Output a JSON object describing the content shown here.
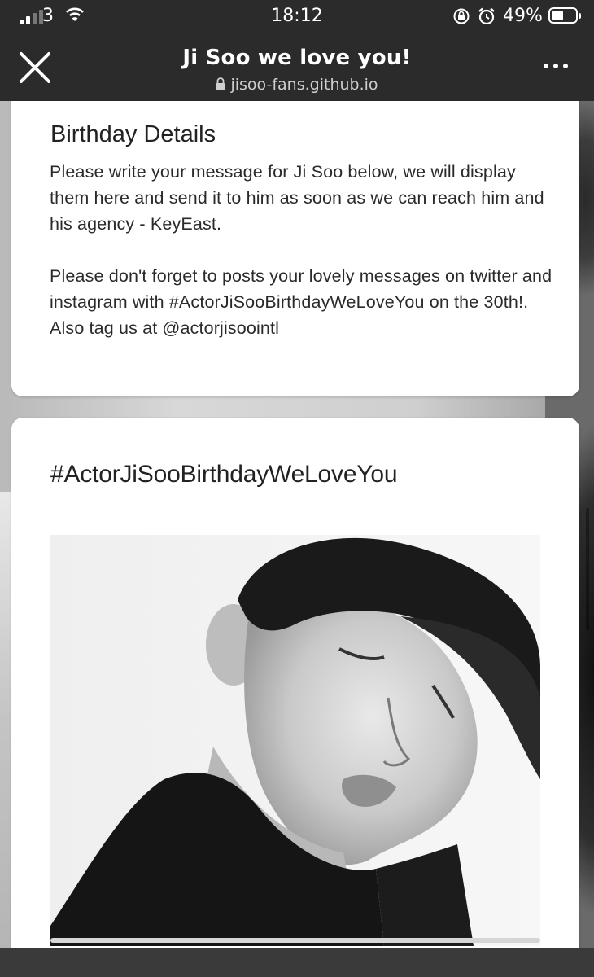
{
  "status_bar": {
    "carrier": "3",
    "time": "18:12",
    "battery_percent": "49%",
    "battery_level": 0.49,
    "icons": [
      "signal-icon",
      "wifi-icon",
      "rotation-lock-icon",
      "alarm-icon",
      "battery-icon"
    ]
  },
  "browser": {
    "title": "Ji Soo we love you!",
    "url": "jisoo-fans.github.io",
    "close_icon": "close-icon",
    "more_icon": "more-icon"
  },
  "birthday_card": {
    "heading": "Birthday Details",
    "paragraphs": [
      "Please write your message for Ji Soo below, we will display them here and send it to him as soon as we can reach him and his agency - KeyEast.",
      "Please don't forget to posts your lovely messages on twitter and instagram with #ActorJiSooBirthdayWeLoveYou on the 30th!. Also tag us at @actorjisoointl"
    ]
  },
  "hashtag_card": {
    "title": "#ActorJiSooBirthdayWeLoveYou"
  }
}
